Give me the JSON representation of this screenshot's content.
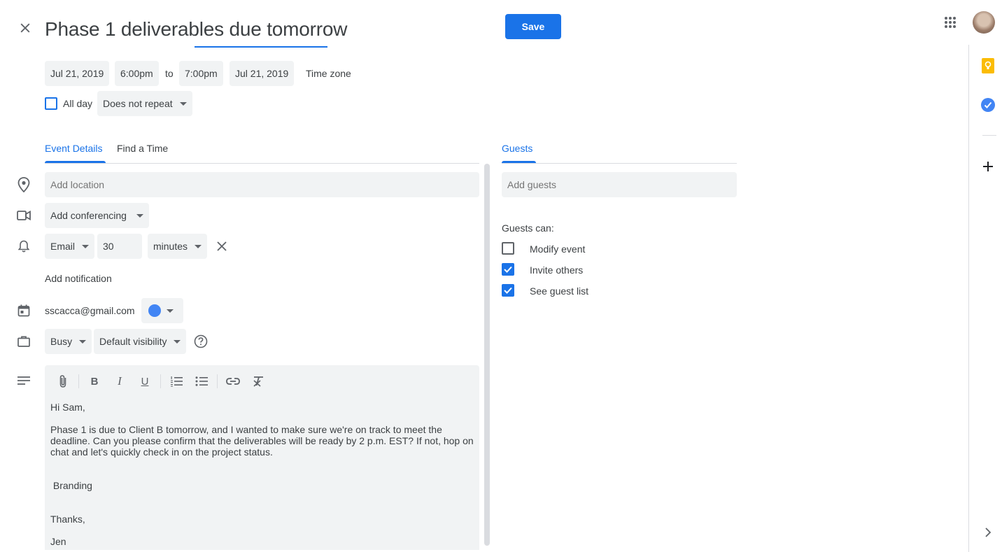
{
  "header": {
    "title": "Phase 1 deliverables due tomorrow",
    "save_label": "Save",
    "close_icon": "close-icon",
    "apps_icon": "apps-grid-icon"
  },
  "datetime": {
    "start_date": "Jul 21, 2019",
    "start_time": "6:00pm",
    "to_label": "to",
    "end_time": "7:00pm",
    "end_date": "Jul 21, 2019",
    "time_zone_label": "Time zone",
    "all_day_label": "All day",
    "all_day_checked": false,
    "repeat_value": "Does not repeat"
  },
  "tabs": {
    "event_details": "Event Details",
    "find_a_time": "Find a Time",
    "guests": "Guests"
  },
  "details": {
    "location_placeholder": "Add location",
    "conferencing_value": "Add conferencing",
    "notification": {
      "method": "Email",
      "amount": "30",
      "unit": "minutes"
    },
    "add_notification_label": "Add notification",
    "calendar_owner": "sscacca@gmail.com",
    "calendar_color": "#4285f4",
    "availability": "Busy",
    "visibility": "Default visibility"
  },
  "description": {
    "lines": [
      "Hi Sam,",
      "Phase 1 is due to Client B tomorrow, and I wanted to make sure we're on track to meet the deadline. Can you please confirm that the deliverables will be ready by 2 p.m. EST? If not, hop on chat and let's quickly check in on the project status.",
      " Branding",
      "Thanks,",
      "Jen"
    ]
  },
  "guests": {
    "add_guests_placeholder": "Add guests",
    "guests_can_label": "Guests can:",
    "permissions": [
      {
        "label": "Modify event",
        "checked": false
      },
      {
        "label": "Invite others",
        "checked": true
      },
      {
        "label": "See guest list",
        "checked": true
      }
    ]
  },
  "colors": {
    "accent": "#1a73e8",
    "chip_bg": "#f1f3f4",
    "keep_yellow": "#fbbc04",
    "tasks_blue": "#4285f4"
  }
}
